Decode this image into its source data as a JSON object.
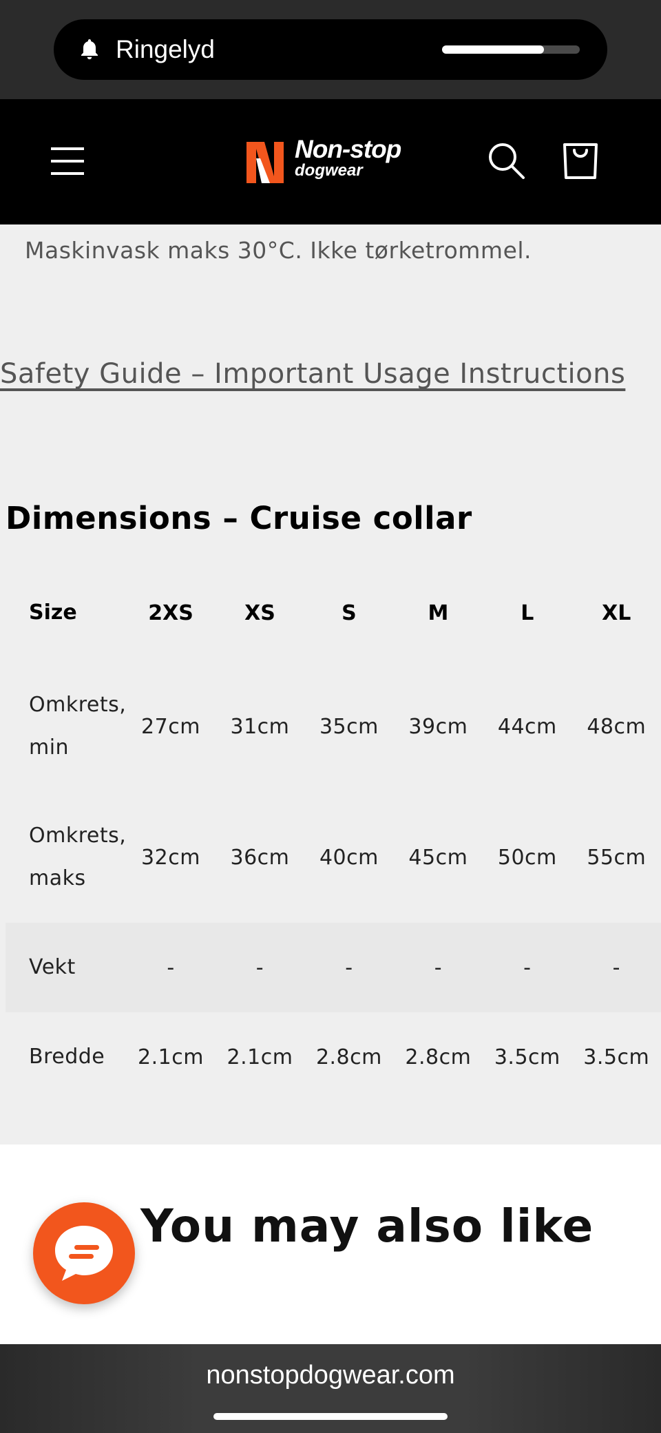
{
  "status": {
    "ringer_label": "Ringelyd",
    "volume_level": 0.74
  },
  "header": {
    "logo_line1": "Non-stop",
    "logo_line2": "dogwear",
    "icons": [
      "menu-icon",
      "search-icon",
      "cart-icon"
    ],
    "brand_color": "#f2561d"
  },
  "content": {
    "care_text": "Maskinvask maks 30°C. Ikke tørketrommel.",
    "safety_link": "Safety Guide – Important Usage Instructions",
    "dimensions_title": "Dimensions – Cruise collar"
  },
  "table": {
    "headers": [
      "Size",
      "2XS",
      "XS",
      "S",
      "M",
      "L",
      "XL"
    ],
    "rows": [
      {
        "label": "Omkrets,\nmin",
        "cells": [
          "27cm",
          "31cm",
          "35cm",
          "39cm",
          "44cm",
          "48cm"
        ]
      },
      {
        "label": "Omkrets,\nmaks",
        "cells": [
          "32cm",
          "36cm",
          "40cm",
          "45cm",
          "50cm",
          "55cm"
        ]
      },
      {
        "label": "Vekt",
        "cells": [
          "-",
          "-",
          "-",
          "-",
          "-",
          "-"
        ]
      },
      {
        "label": "Bredde",
        "cells": [
          "2.1cm",
          "2.1cm",
          "2.8cm",
          "2.8cm",
          "3.5cm",
          "3.5cm"
        ]
      }
    ]
  },
  "recommendations": {
    "title": "You may also like"
  },
  "chat": {
    "icon": "chat-icon"
  },
  "browser": {
    "url": "nonstopdogwear.com"
  }
}
